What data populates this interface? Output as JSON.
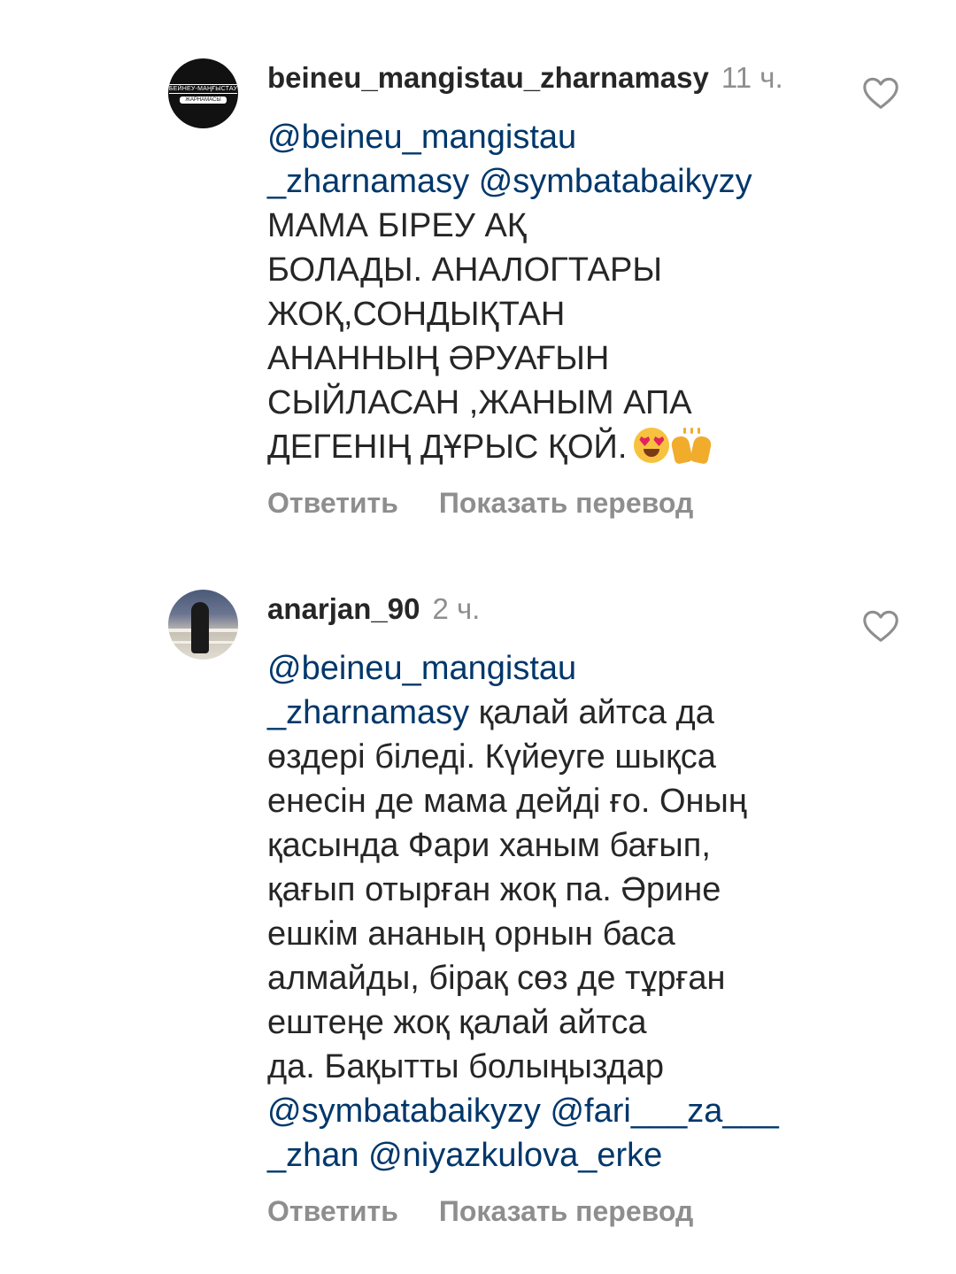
{
  "comments": [
    {
      "avatar_icon": "beineu-mangistau-logo-icon",
      "avatar_text": [
        "БЕЙНЕУ-МАҢҒЫСТАУ",
        "ЖАРНАМАСЫ"
      ],
      "username": "beineu_mangistau_zharnamasy",
      "time": "11 ч.",
      "lines": [
        [
          {
            "t": "@beineu_mangistau",
            "m": true
          }
        ],
        [
          {
            "t": "_zharnamasy",
            "m": true
          },
          {
            "t": " ",
            "m": false
          },
          {
            "t": "@symbatabaikyzy",
            "m": true
          }
        ],
        [
          {
            "t": "МАМА БІРЕУ АҚ",
            "m": false
          }
        ],
        [
          {
            "t": "БОЛАДЫ. АНАЛОГТАРЫ",
            "m": false
          }
        ],
        [
          {
            "t": "ЖОҚ,СОНДЫҚТАН",
            "m": false
          }
        ],
        [
          {
            "t": "АНАННЫҢ ӘРУАҒЫН",
            "m": false
          }
        ],
        [
          {
            "t": "СЫЙЛАСАН ,ЖАНЫМ АПА",
            "m": false
          }
        ],
        [
          {
            "t": "ДЕГЕНІҢ ДҰРЫС ҚОЙ.",
            "m": false
          }
        ]
      ],
      "emojis": [
        "heart-eyes-emoji",
        "raising-hands-emoji"
      ],
      "reply_label": "Ответить",
      "translate_label": "Показать перевод"
    },
    {
      "avatar_icon": "user-photo-avatar",
      "username": "anarjan_90",
      "time": "2 ч.",
      "lines": [
        [
          {
            "t": "@beineu_mangistau",
            "m": true
          }
        ],
        [
          {
            "t": "_zharnamasy",
            "m": true
          },
          {
            "t": " қалай айтса да",
            "m": false
          }
        ],
        [
          {
            "t": "өздері біледі. Күйеуге шықса",
            "m": false
          }
        ],
        [
          {
            "t": "енесін де мама дейді ғо. Оның",
            "m": false
          }
        ],
        [
          {
            "t": "қасында Фари ханым бағып,",
            "m": false
          }
        ],
        [
          {
            "t": "қағып отырған жоқ па. Әрине",
            "m": false
          }
        ],
        [
          {
            "t": "ешкім ананың орнын баса",
            "m": false
          }
        ],
        [
          {
            "t": "алмайды, бірақ сөз де тұрған",
            "m": false
          }
        ],
        [
          {
            "t": "ештеңе жоқ қалай айтса",
            "m": false
          }
        ],
        [
          {
            "t": "да. Бақытты болыңыздар",
            "m": false
          }
        ],
        [
          {
            "t": "@symbatabaikyzy",
            "m": true
          },
          {
            "t": " ",
            "m": false
          },
          {
            "t": "@fari___za___",
            "m": true
          }
        ],
        [
          {
            "t": "_zhan",
            "m": true
          },
          {
            "t": " ",
            "m": false
          },
          {
            "t": "@niyazkulova_erke",
            "m": true
          }
        ]
      ],
      "reply_label": "Ответить",
      "translate_label": "Показать перевод"
    }
  ],
  "colors": {
    "mention": "#00376b",
    "text": "#262626",
    "secondary": "#8e8e8e"
  },
  "icons": {
    "like": "heart-outline-icon"
  }
}
